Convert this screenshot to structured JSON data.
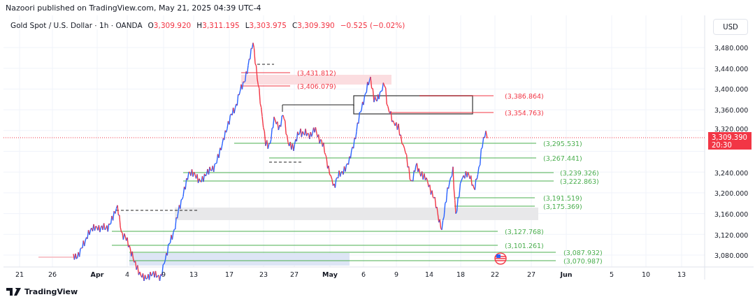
{
  "header": {
    "text": "Nazoori published on TradingView.com, May 21, 2025 04:39 UTC-4"
  },
  "legend": {
    "symbol": "Gold Spot / U.S. Dollar · 1h · OANDA",
    "ohlc": [
      {
        "label": "O",
        "value": "3,309.920"
      },
      {
        "label": "H",
        "value": "3,311.195"
      },
      {
        "label": "L",
        "value": "3,303.975"
      },
      {
        "label": "C",
        "value": "3,309.390"
      }
    ],
    "change": "−0.525 (−0.02%)"
  },
  "currency_button": "USD",
  "price_axis": [
    "3,480.000",
    "3,440.000",
    "3,400.000",
    "3,360.000",
    "3,320.000",
    "3,240.000",
    "3,200.000",
    "3,160.000",
    "3,120.000",
    "3,080.000"
  ],
  "price_badge": {
    "price": "3,309.390",
    "countdown": "20:30"
  },
  "levels": [
    {
      "label": "(3,431.812)",
      "color": "#f23645"
    },
    {
      "label": "(3,406.079)",
      "color": "#f23645"
    },
    {
      "label": "(3,386.864)",
      "color": "#f23645"
    },
    {
      "label": "(3,354.763)",
      "color": "#f23645"
    },
    {
      "label": "(3,295.531)",
      "color": "#4caf50"
    },
    {
      "label": "(3,267.441)",
      "color": "#4caf50"
    },
    {
      "label": "(3,239.326)",
      "color": "#4caf50"
    },
    {
      "label": "(3,222.863)",
      "color": "#4caf50"
    },
    {
      "label": "(3,191.519)",
      "color": "#4caf50"
    },
    {
      "label": "(3,175.369)",
      "color": "#4caf50"
    },
    {
      "label": "(3,127.768)",
      "color": "#4caf50"
    },
    {
      "label": "(3,101.261)",
      "color": "#4caf50"
    },
    {
      "label": "(3,087.932)",
      "color": "#4caf50"
    },
    {
      "label": "(3,070.987)",
      "color": "#4caf50"
    }
  ],
  "time_axis": [
    {
      "label": "21",
      "kind": "day"
    },
    {
      "label": "26",
      "kind": "day"
    },
    {
      "label": "Apr",
      "kind": "month"
    },
    {
      "label": "4",
      "kind": "day"
    },
    {
      "label": "9",
      "kind": "day"
    },
    {
      "label": "13",
      "kind": "day"
    },
    {
      "label": "17",
      "kind": "day"
    },
    {
      "label": "23",
      "kind": "day"
    },
    {
      "label": "27",
      "kind": "day"
    },
    {
      "label": "May",
      "kind": "month"
    },
    {
      "label": "6",
      "kind": "day"
    },
    {
      "label": "9",
      "kind": "day"
    },
    {
      "label": "14",
      "kind": "day"
    },
    {
      "label": "18",
      "kind": "day"
    },
    {
      "label": "22",
      "kind": "day"
    },
    {
      "label": "27",
      "kind": "day"
    },
    {
      "label": "Jun",
      "kind": "month"
    },
    {
      "label": "5",
      "kind": "day"
    },
    {
      "label": "10",
      "kind": "day"
    },
    {
      "label": "13",
      "kind": "day"
    }
  ],
  "footer": {
    "brand": "TradingView"
  }
}
